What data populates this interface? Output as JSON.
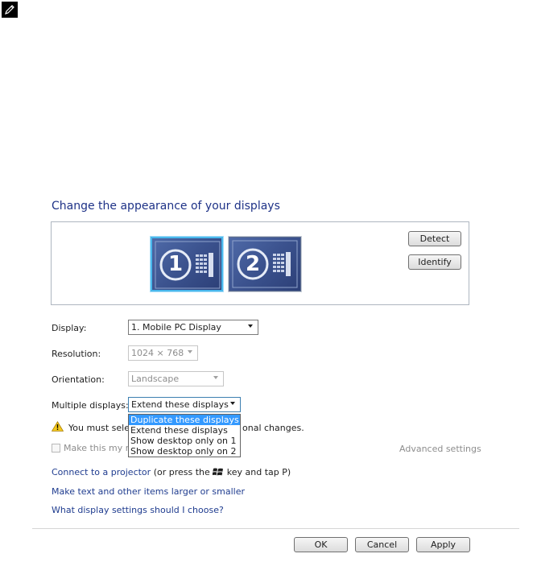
{
  "title": "Change the appearance of your displays",
  "monitors": [
    {
      "number": "1",
      "selected": true
    },
    {
      "number": "2",
      "selected": false
    }
  ],
  "buttons": {
    "detect": "Detect",
    "identify": "Identify",
    "ok": "OK",
    "cancel": "Cancel",
    "apply": "Apply"
  },
  "fields": {
    "display": {
      "label": "Display:",
      "value": "1. Mobile PC Display"
    },
    "resolution": {
      "label": "Resolution:",
      "value": "1024 × 768"
    },
    "orientation": {
      "label": "Orientation:",
      "value": "Landscape"
    },
    "multiple_displays": {
      "label": "Multiple displays:",
      "value": "Extend these displays"
    }
  },
  "dropdown_options": [
    "Duplicate these displays",
    "Extend these displays",
    "Show desktop only on 1",
    "Show desktop only on 2"
  ],
  "warning": {
    "prefix": "You must selec",
    "suffix": "onal changes."
  },
  "checkbox_label": "Make this my m",
  "advanced_settings": "Advanced settings",
  "links": {
    "projector": "Connect to a projector",
    "projector_hint_prefix": "(or press the",
    "projector_hint_suffix": "key and tap P)",
    "text_size": "Make text and other items larger or smaller",
    "which_settings": "What display settings should I choose?"
  },
  "icons": [
    "pencil-note-icon",
    "warning-icon",
    "windows-logo-icon"
  ],
  "colors": {
    "title": "#1e3287",
    "link": "#1f3c8f",
    "selection": "#3399ff",
    "monitor": "#3b528e"
  }
}
